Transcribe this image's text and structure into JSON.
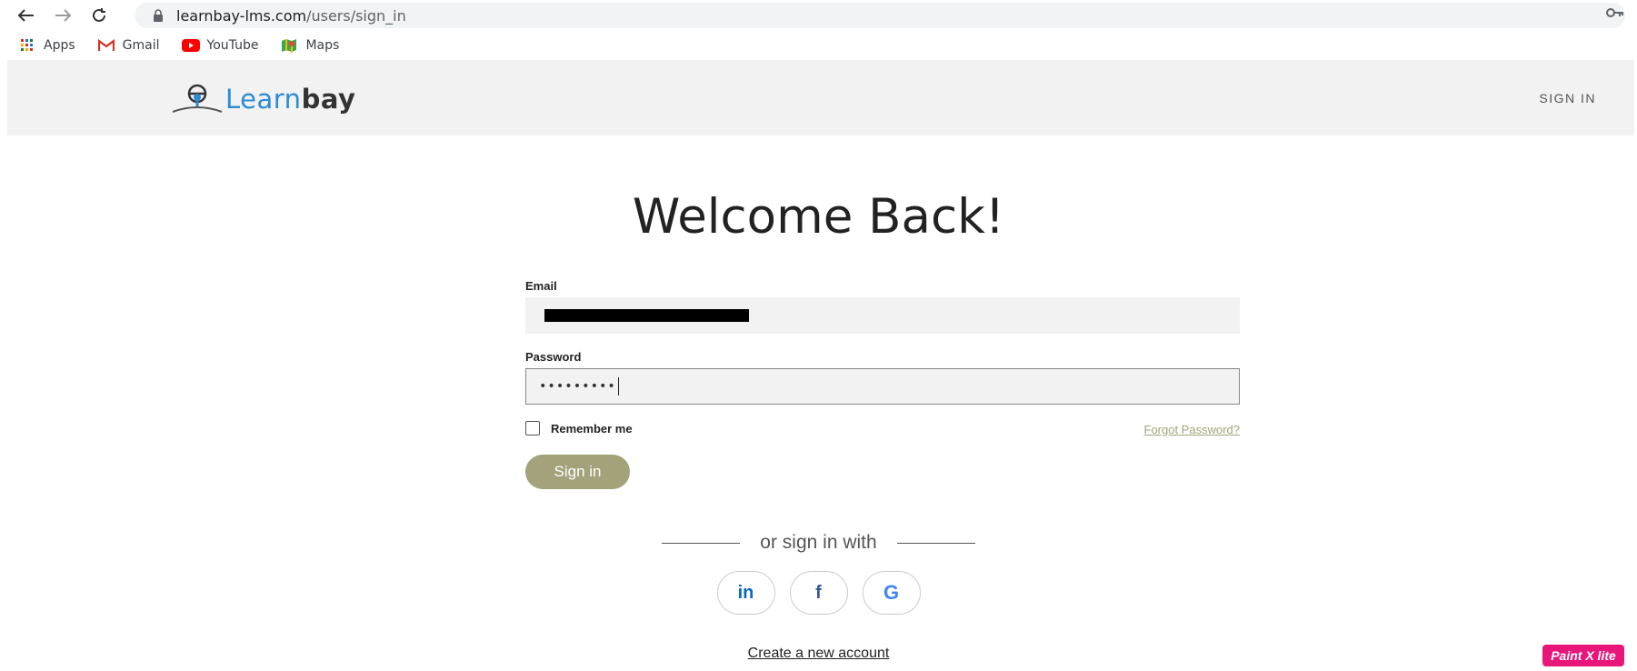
{
  "browser": {
    "url_host": "learnbay-lms.com",
    "url_path": "/users/sign_in",
    "bookmarks": [
      {
        "label": "Apps",
        "icon": "apps-grid-icon"
      },
      {
        "label": "Gmail",
        "icon": "gmail-icon"
      },
      {
        "label": "YouTube",
        "icon": "youtube-icon"
      },
      {
        "label": "Maps",
        "icon": "maps-icon"
      }
    ]
  },
  "header": {
    "logo_learn": "Learn",
    "logo_bay": "bay",
    "signin_label": "SIGN IN"
  },
  "main": {
    "title": "Welcome Back!",
    "email_label": "Email",
    "password_label": "Password",
    "password_value": "•••••••••",
    "remember_label": "Remember me",
    "forgot_label": "Forgot Password?",
    "signin_button": "Sign in",
    "or_text": "or sign in with",
    "social": {
      "linkedin": "in",
      "facebook": "f",
      "google": "G"
    },
    "create_account": "Create a new account"
  },
  "overlay": {
    "badge": "Paint X lite"
  },
  "colors": {
    "accent": "#a3a27a",
    "header_bg": "#f2f2f2",
    "badge_bg": "#e8157a"
  }
}
